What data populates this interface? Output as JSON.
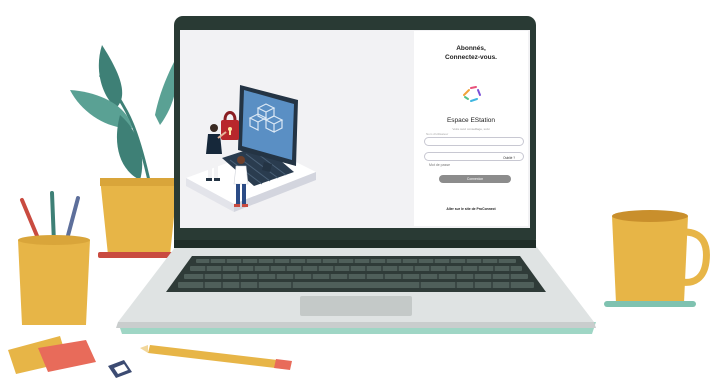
{
  "login": {
    "title_line1": "Abonnés,",
    "title_line2": "Connectez-vous.",
    "app_name": "Espace EStation",
    "subtitle": "Votre suivi conseillage, suivi",
    "username_label": "Nom d'utilisateur",
    "password_placeholder": "Mot de passe",
    "forgot_link": "Oublié ?",
    "connect_button": "Connexion",
    "proconnect_link": "Aller sur le site de ProConnect"
  },
  "icons": [
    "laptop-icon",
    "plant-icon",
    "pencil-cup-icon",
    "coffee-mug-icon",
    "pencil-icon",
    "eraser-icon",
    "sticky-notes-icon",
    "computer-monitor-icon",
    "padlock-icon",
    "app-logo-icon"
  ],
  "colors": {
    "laptop_frame": "#293a34",
    "mustard": "#e7b547",
    "teal_leaf": "#3e8076",
    "button_grey": "#8c8c8c",
    "base_mint": "#9fd6c5"
  }
}
